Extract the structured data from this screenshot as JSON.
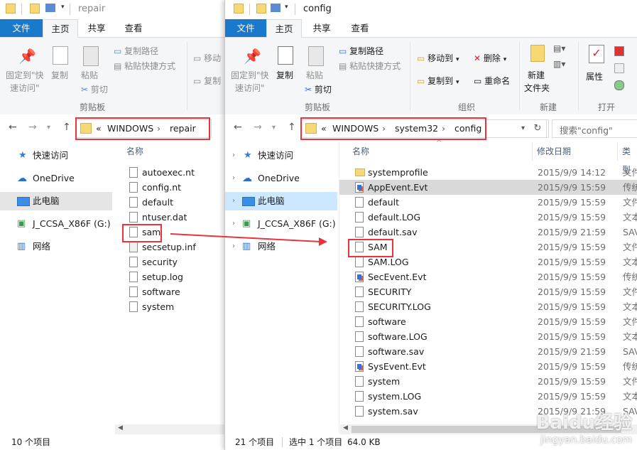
{
  "window1": {
    "title": "repair",
    "tabs": [
      "文件",
      "主页",
      "共享",
      "查看"
    ],
    "ribbon": {
      "pin_label_1": "固定到\"快",
      "pin_label_2": "速访问\"",
      "copy": "复制",
      "paste": "粘贴",
      "copy_path": "复制路径",
      "paste_shortcut": "粘贴快捷方式",
      "cut": "剪切",
      "clipboard_group": "剪贴板",
      "move_to": "移动",
      "copy_to": "复制"
    },
    "breadcrumb": [
      "WINDOWS",
      "repair"
    ],
    "breadcrumb_prefix": "«",
    "nav": [
      "快速访问",
      "OneDrive",
      "此电脑",
      "J_CCSA_X86F (G:)",
      "网络"
    ],
    "column_name": "名称",
    "files": [
      {
        "name": "autoexec.nt",
        "icon": "doc"
      },
      {
        "name": "config.nt",
        "icon": "doc"
      },
      {
        "name": "default",
        "icon": "doc"
      },
      {
        "name": "ntuser.dat",
        "icon": "doc"
      },
      {
        "name": "sam",
        "icon": "doc"
      },
      {
        "name": "secsetup.inf",
        "icon": "inf"
      },
      {
        "name": "security",
        "icon": "doc"
      },
      {
        "name": "setup.log",
        "icon": "doc"
      },
      {
        "name": "software",
        "icon": "doc"
      },
      {
        "name": "system",
        "icon": "doc"
      }
    ],
    "status": "10 个项目"
  },
  "window2": {
    "title": "config",
    "tabs": [
      "文件",
      "主页",
      "共享",
      "查看"
    ],
    "ribbon": {
      "pin_label_1": "固定到\"快",
      "pin_label_2": "速访问\"",
      "copy": "复制",
      "paste": "粘贴",
      "copy_path": "复制路径",
      "paste_shortcut": "粘贴快捷方式",
      "cut": "剪切",
      "clipboard_group": "剪贴板",
      "move_to": "移动到",
      "copy_to": "复制到",
      "delete": "删除",
      "rename": "重命名",
      "organize_group": "组织",
      "new_folder_1": "新建",
      "new_folder_2": "文件夹",
      "new_group": "新建",
      "properties": "属性",
      "open_group": "打开"
    },
    "breadcrumb": [
      "WINDOWS",
      "system32",
      "config"
    ],
    "breadcrumb_prefix": "«",
    "search_placeholder": "搜索\"config\"",
    "nav": [
      "快速访问",
      "OneDrive",
      "此电脑",
      "J_CCSA_X86F (G:)",
      "网络"
    ],
    "column_name": "名称",
    "column_date": "修改日期",
    "column_type": "类型",
    "files": [
      {
        "name": "systemprofile",
        "date": "2015/9/9 14:12",
        "type": "文件",
        "icon": "folder"
      },
      {
        "name": "AppEvent.Evt",
        "date": "2015/9/9 15:59",
        "type": "传统",
        "icon": "evt"
      },
      {
        "name": "default",
        "date": "2015/9/9 15:59",
        "type": "文件",
        "icon": "doc"
      },
      {
        "name": "default.LOG",
        "date": "2015/9/9 15:59",
        "type": "文本",
        "icon": "doc"
      },
      {
        "name": "default.sav",
        "date": "2015/9/9 21:59",
        "type": "SAV",
        "icon": "doc"
      },
      {
        "name": "SAM",
        "date": "2015/9/9 15:59",
        "type": "文件",
        "icon": "doc"
      },
      {
        "name": "SAM.LOG",
        "date": "2015/9/9 15:59",
        "type": "文本",
        "icon": "doc"
      },
      {
        "name": "SecEvent.Evt",
        "date": "2015/9/9 15:59",
        "type": "传统",
        "icon": "evt"
      },
      {
        "name": "SECURITY",
        "date": "2015/9/9 15:59",
        "type": "文件",
        "icon": "doc"
      },
      {
        "name": "SECURITY.LOG",
        "date": "2015/9/9 15:59",
        "type": "文本",
        "icon": "doc"
      },
      {
        "name": "software",
        "date": "2015/9/9 15:59",
        "type": "文件",
        "icon": "doc"
      },
      {
        "name": "software.LOG",
        "date": "2015/9/9 15:59",
        "type": "文本",
        "icon": "doc"
      },
      {
        "name": "software.sav",
        "date": "2015/9/9 21:59",
        "type": "SAV",
        "icon": "doc"
      },
      {
        "name": "SysEvent.Evt",
        "date": "2015/9/9 15:59",
        "type": "传统",
        "icon": "evt"
      },
      {
        "name": "system",
        "date": "2015/9/9 15:59",
        "type": "文件",
        "icon": "doc"
      },
      {
        "name": "system.LOG",
        "date": "2015/9/9 15:59",
        "type": "文本",
        "icon": "doc"
      },
      {
        "name": "system.sav",
        "date": "2015/9/9 21:59",
        "type": "SAV",
        "icon": "doc"
      }
    ],
    "status_count": "21 个项目",
    "status_selected": "选中 1 个项目",
    "status_size": "64.0 KB"
  },
  "watermark": "Baidu经验",
  "watermark_url": "jingyan.baidu.com",
  "colors": {
    "accent": "#1979ca",
    "highlight": "#e8343a",
    "nav_selected": "#cce8ff"
  }
}
